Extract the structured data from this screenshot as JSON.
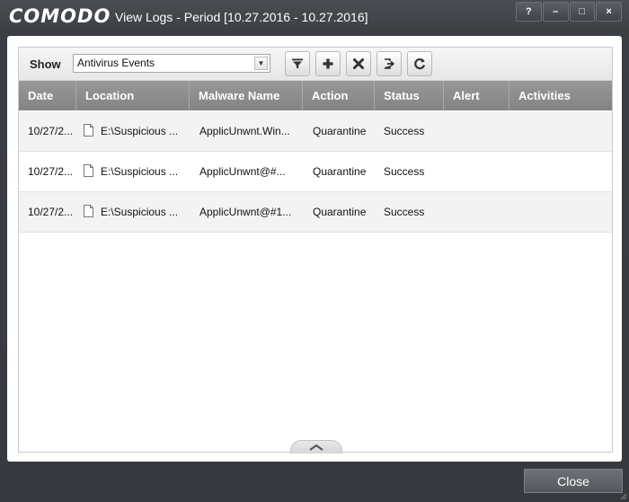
{
  "window": {
    "logo": "COMODO",
    "title": "View Logs - Period [10.27.2016 - 10.27.2016]",
    "controls": {
      "help": "?",
      "minimize": "–",
      "maximize": "□",
      "close": "×"
    }
  },
  "toolbar": {
    "show_label": "Show",
    "filter_value": "Antivirus Events",
    "buttons": [
      "filter-icon",
      "add-icon",
      "remove-icon",
      "export-icon",
      "refresh-icon"
    ]
  },
  "table": {
    "columns": [
      "Date",
      "Location",
      "Malware Name",
      "Action",
      "Status",
      "Alert",
      "Activities"
    ],
    "rows": [
      {
        "date": "10/27/2...",
        "location": "E:\\Suspicious ...",
        "malware": "ApplicUnwnt.Win...",
        "action": "Quarantine",
        "status": "Success",
        "alert": "",
        "activities": ""
      },
      {
        "date": "10/27/2...",
        "location": "E:\\Suspicious ...",
        "malware": "ApplicUnwnt@#...",
        "action": "Quarantine",
        "status": "Success",
        "alert": "",
        "activities": ""
      },
      {
        "date": "10/27/2...",
        "location": "E:\\Suspicious ...",
        "malware": "ApplicUnwnt@#1...",
        "action": "Quarantine",
        "status": "Success",
        "alert": "",
        "activities": ""
      }
    ]
  },
  "footer": {
    "close_label": "Close"
  },
  "colors": {
    "window_bg": "#3a3d41",
    "header_bg": "#8c8c8c",
    "panel_bg": "#ffffff"
  }
}
